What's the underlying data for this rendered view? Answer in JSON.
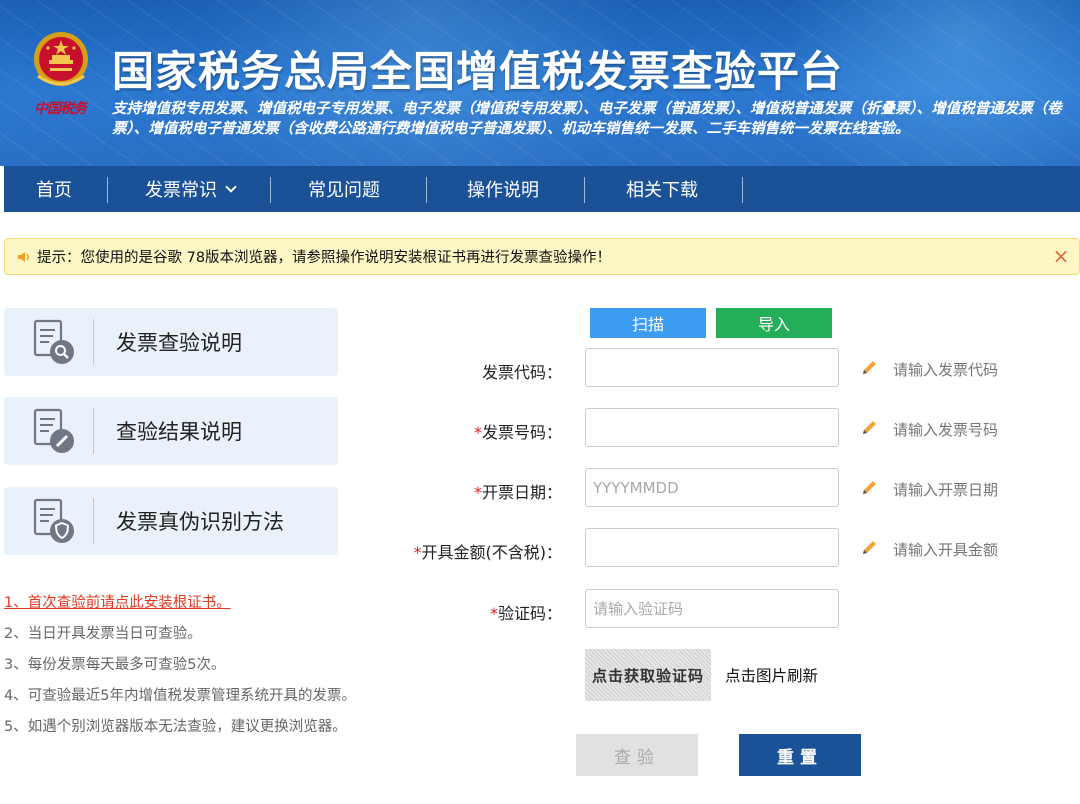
{
  "header": {
    "title": "国家税务总局全国增值税发票查验平台",
    "emblem_caption": "中国税务",
    "subtitle": "支持增值税专用发票、增值税电子专用发票、电子发票（增值税专用发票）、电子发票（普通发票）、增值税普通发票（折叠票）、增值税普通发票（卷票）、增值税电子普通发票（含收费公路通行费增值税电子普通发票）、机动车销售统一发票、二手车销售统一发票在线查验。"
  },
  "nav": {
    "items": [
      {
        "label": "首页"
      },
      {
        "label": "发票常识"
      },
      {
        "label": "常见问题"
      },
      {
        "label": "操作说明"
      },
      {
        "label": "相关下载"
      }
    ]
  },
  "notice": {
    "text": "提示：您使用的是谷歌 78版本浏览器，请参照操作说明安装根证书再进行发票查验操作！",
    "close": "×"
  },
  "cards": [
    {
      "label": "发票查验说明"
    },
    {
      "label": "查验结果说明"
    },
    {
      "label": "发票真伪识别方法"
    }
  ],
  "tips": {
    "t1": "1、首次查验前请点此安装根证书。",
    "t2": "2、当日开具发票当日可查验。",
    "t3": "3、每份发票每天最多可查验5次。",
    "t4": "4、可查验最近5年内增值税发票管理系统开具的发票。",
    "t5": "5、如遇个别浏览器版本无法查验，建议更换浏览器。"
  },
  "form": {
    "scan_label": "扫描",
    "import_label": "导入",
    "code": {
      "label": "发票代码：",
      "value": "",
      "placeholder": "",
      "hint": "请输入发票代码"
    },
    "number": {
      "star": "*",
      "label": "发票号码：",
      "value": "",
      "placeholder": "",
      "hint": "请输入发票号码"
    },
    "date": {
      "star": "*",
      "label": "开票日期：",
      "value": "",
      "placeholder": "YYYYMMDD",
      "hint": "请输入开票日期"
    },
    "amount": {
      "star": "*",
      "label": "开具金额(不含税)：",
      "value": "",
      "placeholder": "",
      "hint": "请输入开具金额"
    },
    "captcha": {
      "star": "*",
      "label": "验证码：",
      "value": "",
      "placeholder": "请输入验证码"
    },
    "captcha_image_text": "点击获取验证码",
    "captcha_refresh": "点击图片刷新",
    "check_label": "查验",
    "reset_label": "重置"
  },
  "colors": {
    "nav_bg": "#1b5297",
    "scan": "#3c9cf0",
    "import": "#24ae58",
    "required_star": "#e02020",
    "tip_link": "#e03a1e"
  }
}
